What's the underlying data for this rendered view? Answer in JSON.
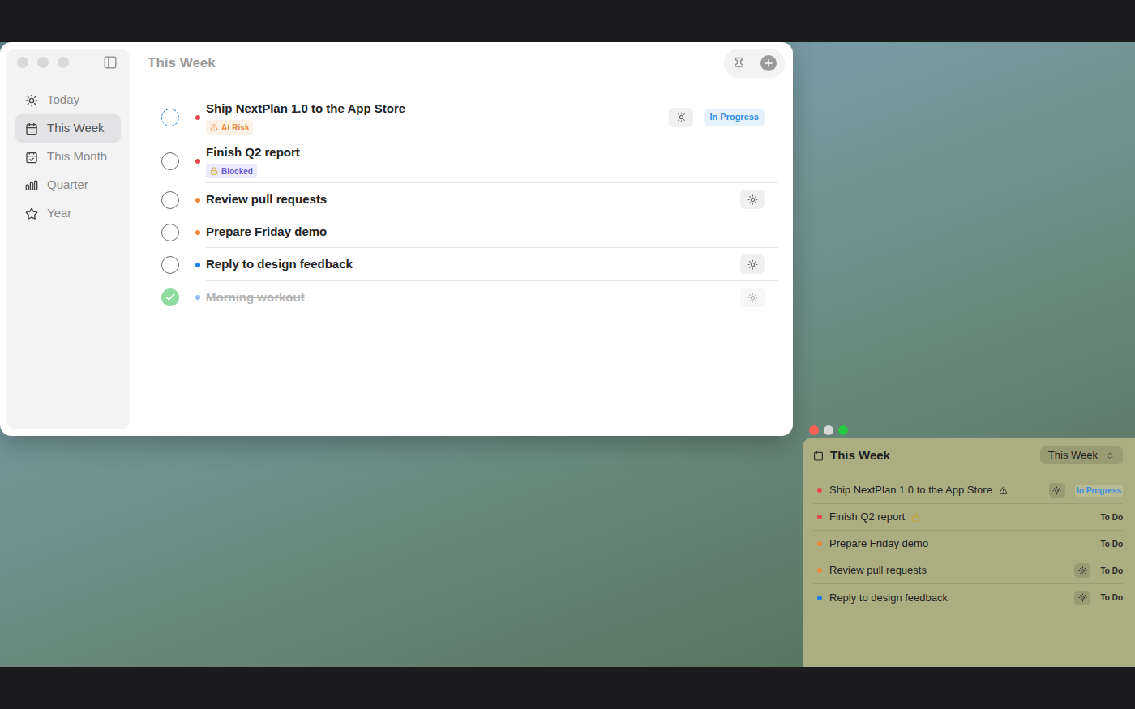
{
  "window": {
    "title": "This Week"
  },
  "sidebar": {
    "items": [
      {
        "label": "Today",
        "selected": false
      },
      {
        "label": "This Week",
        "selected": true
      },
      {
        "label": "This Month",
        "selected": false
      },
      {
        "label": "Quarter",
        "selected": false
      },
      {
        "label": "Year",
        "selected": false
      }
    ]
  },
  "tasks": [
    {
      "title": "Ship NextPlan 1.0 to the App Store",
      "state": "in_progress",
      "color": "#e5484d",
      "badge": {
        "label": "At Risk",
        "kind": "at-risk",
        "color": "#e8883a"
      },
      "today": true,
      "status": "In Progress"
    },
    {
      "title": "Finish Q2 report",
      "state": "todo",
      "color": "#e5484d",
      "badge": {
        "label": "Blocked",
        "kind": "blocked",
        "color": "#6b5bd6"
      },
      "today": false,
      "status": null
    },
    {
      "title": "Review pull requests",
      "state": "todo",
      "color": "#f0883a",
      "badge": null,
      "today": true,
      "status": null
    },
    {
      "title": "Prepare Friday demo",
      "state": "todo",
      "color": "#f0883a",
      "badge": null,
      "today": false,
      "status": null
    },
    {
      "title": "Reply to design feedback",
      "state": "todo",
      "color": "#1a7ff0",
      "badge": null,
      "today": true,
      "status": null
    },
    {
      "title": "Morning workout",
      "state": "done",
      "color": "#8ec0f5",
      "badge": null,
      "today": true,
      "status": null
    }
  ],
  "widget": {
    "title": "This Week",
    "picker": "This Week",
    "rows": [
      {
        "title": "Ship NextPlan 1.0 to the App Store",
        "color": "#e5484d",
        "flag": "at-risk",
        "today": true,
        "status": "In Progress",
        "status_kind": "in_progress"
      },
      {
        "title": "Finish Q2 report",
        "color": "#e5484d",
        "flag": "blocked",
        "today": false,
        "status": "To Do",
        "status_kind": "todo"
      },
      {
        "title": "Prepare Friday demo",
        "color": "#f0883a",
        "flag": null,
        "today": false,
        "status": "To Do",
        "status_kind": "todo"
      },
      {
        "title": "Review pull requests",
        "color": "#f0883a",
        "flag": null,
        "today": true,
        "status": "To Do",
        "status_kind": "todo"
      },
      {
        "title": "Reply to design feedback",
        "color": "#1a7ff0",
        "flag": null,
        "today": true,
        "status": "To Do",
        "status_kind": "todo"
      }
    ]
  }
}
